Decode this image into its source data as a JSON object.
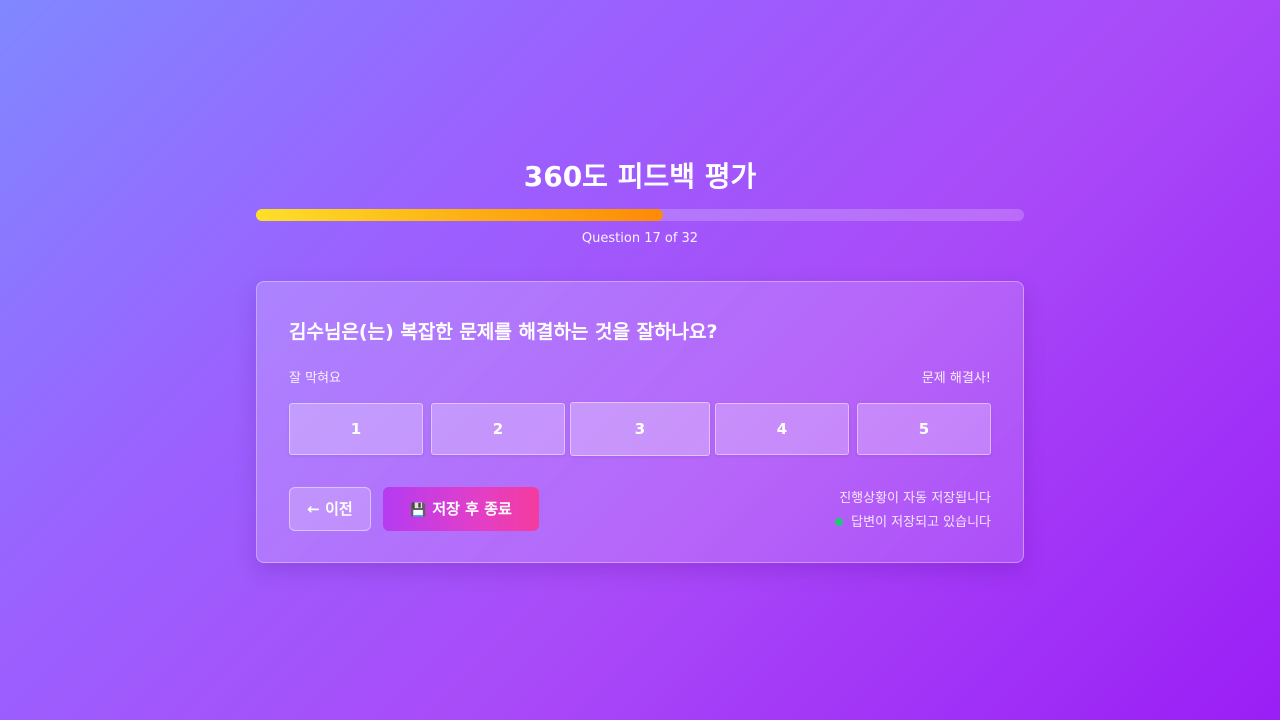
{
  "page": {
    "title": "360도 피드백 평가"
  },
  "progress": {
    "current": 17,
    "total": 32,
    "fraction": 0.53,
    "text": "Question 17 of 32"
  },
  "question": {
    "text": "김수님은(는) 복잡한 문제를 해결하는 것을 잘하나요?",
    "scale_low_label": "잘 막혀요",
    "scale_high_label": "문제 해결사!",
    "options": [
      "1",
      "2",
      "3",
      "4",
      "5"
    ]
  },
  "nav": {
    "prev_label": "← 이전",
    "save_exit_label": "저장 후 종료",
    "save_icon": "floppy-disk-icon"
  },
  "status": {
    "autosave_text": "진행상황이 자동 저장됩니다",
    "saving_text": "답변이 저장되고 있습니다",
    "saving_color": "#22c77a"
  },
  "colors": {
    "progress_start": "#fde02a",
    "progress_end": "#fd8a08",
    "save_button_start": "#b43cf2",
    "save_button_end": "#f43c9e"
  }
}
